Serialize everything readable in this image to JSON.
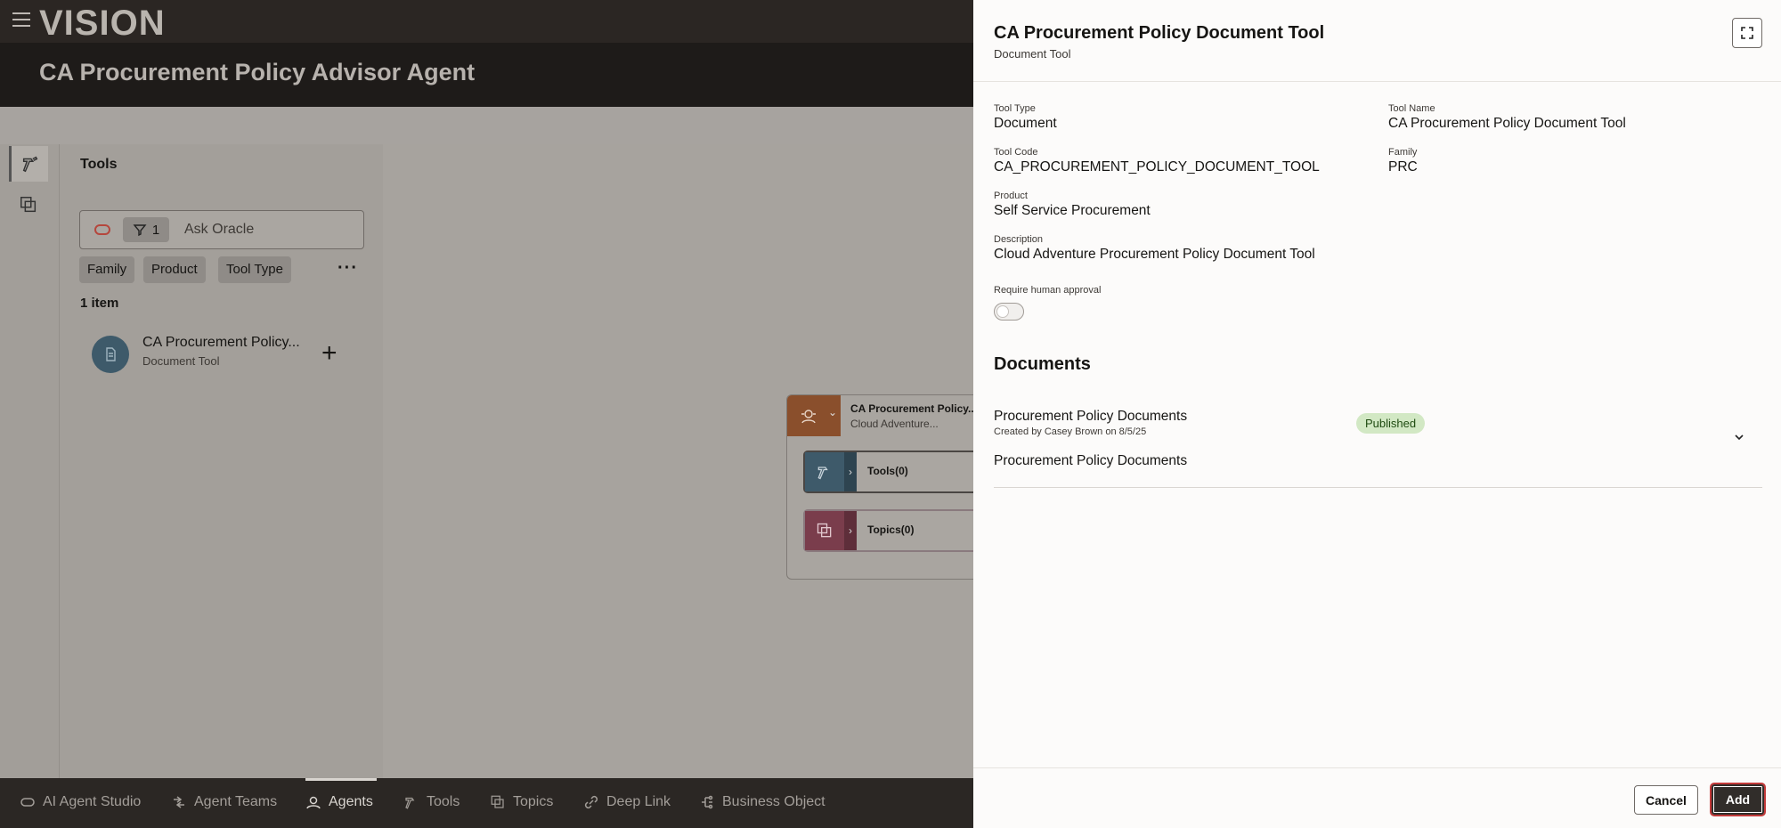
{
  "app": {
    "brand": "VISION",
    "page_title": "CA Procurement Policy Advisor Agent"
  },
  "tools_panel": {
    "title": "Tools",
    "search_placeholder": "Ask Oracle",
    "filter_count": "1",
    "filters": [
      "Family",
      "Product",
      "Tool Type"
    ],
    "more": "···",
    "item_count": "1 item",
    "items": [
      {
        "name": "CA Procurement Policy...",
        "subtitle": "Document Tool",
        "icon": "document-icon"
      }
    ],
    "add_symbol": "+"
  },
  "canvas": {
    "agent": {
      "name": "CA Procurement Policy...",
      "subtitle": "Cloud Adventure..."
    },
    "tools_node": {
      "label": "Tools(0)",
      "color": "#3e5a6a"
    },
    "topics_node": {
      "label": "Topics(0)",
      "color": "#7a3d4c"
    },
    "agent_color": "#8a4f2c"
  },
  "bottom_nav": [
    {
      "label": "AI Agent Studio",
      "icon": "oracle-ring-icon"
    },
    {
      "label": "Agent Teams",
      "icon": "agent-teams-icon"
    },
    {
      "label": "Agents",
      "icon": "agents-icon",
      "active": true
    },
    {
      "label": "Tools",
      "icon": "tools-icon"
    },
    {
      "label": "Topics",
      "icon": "topics-icon"
    },
    {
      "label": "Deep Link",
      "icon": "link-icon"
    },
    {
      "label": "Business Object",
      "icon": "business-object-icon"
    }
  ],
  "drawer": {
    "title": "CA Procurement Policy Document Tool",
    "subtitle": "Document Tool",
    "fields": {
      "tool_type": {
        "label": "Tool Type",
        "value": "Document"
      },
      "tool_name": {
        "label": "Tool Name",
        "value": "CA Procurement Policy Document Tool"
      },
      "tool_code": {
        "label": "Tool Code",
        "value": "CA_PROCUREMENT_POLICY_DOCUMENT_TOOL"
      },
      "family": {
        "label": "Family",
        "value": "PRC"
      },
      "product": {
        "label": "Product",
        "value": "Self Service Procurement"
      },
      "description": {
        "label": "Description",
        "value": "Cloud Adventure Procurement Policy Document Tool"
      },
      "approval": {
        "label": "Require human approval",
        "value": false
      }
    },
    "documents_heading": "Documents",
    "documents": [
      {
        "name": "Procurement Policy Documents",
        "meta": "Created by Casey Brown on 8/5/25",
        "status": "Published",
        "description": "Procurement Policy Documents"
      }
    ],
    "cancel_label": "Cancel",
    "add_label": "Add",
    "status_color": "#d2e8c4"
  }
}
